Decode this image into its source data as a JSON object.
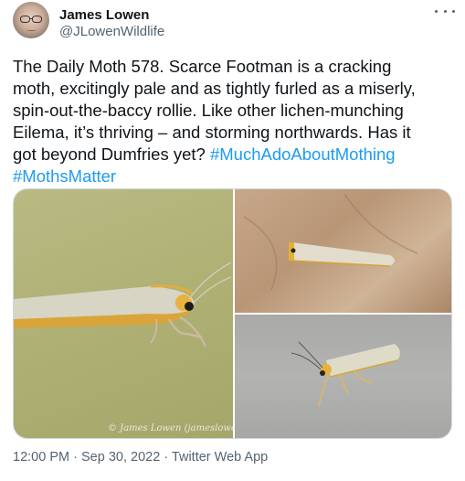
{
  "author": {
    "name": "James Lowen",
    "handle": "@JLowenWildlife"
  },
  "tweet": {
    "text": "The Daily Moth 578. Scarce Footman is a cracking\nmoth, excitingly pale and as tightly furled as a miserly,\nspin-out-the-baccy rollie. Like other lichen-munching\nEilema, it’s thriving – and storming northwards. Has it\ngot beyond Dumfries yet? ",
    "hashtags": [
      "#MuchAdoAboutMothing",
      "#MothsMatter"
    ]
  },
  "media": {
    "photo1_credit": "© James Lowen (jameslowe"
  },
  "meta": {
    "time": "12:00 PM",
    "separator": "·",
    "date": "Sep 30, 2022",
    "source": "Twitter Web App"
  },
  "colors": {
    "link": "#1d9bf0",
    "secondary_text": "#536471",
    "primary_text": "#0f1419"
  },
  "icons": {
    "more": "more-horizontal-icon"
  }
}
